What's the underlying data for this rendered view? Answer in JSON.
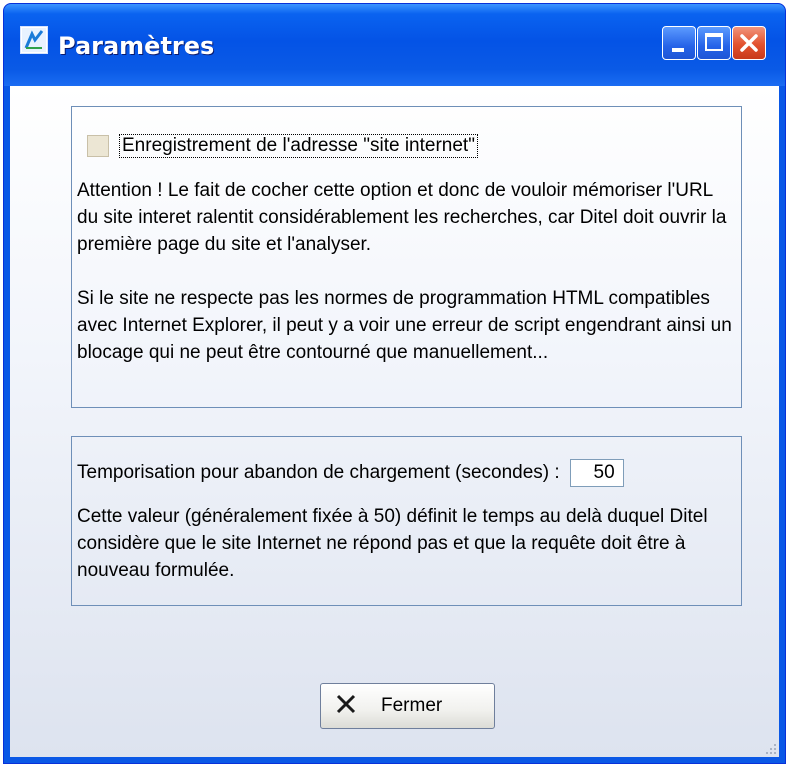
{
  "window": {
    "title": "Paramètres",
    "icon": "app-icon"
  },
  "internet_address": {
    "checkbox_label": "Enregistrement de l'adresse \"site internet\"",
    "checked": false,
    "warning_text": "Attention ! Le fait de cocher cette option et donc de vouloir mémoriser l'URL du site interet ralentit considérablement les recherches, car Ditel doit ouvrir la première page du site et l'analyser.",
    "script_text": "Si le site ne respecte pas les normes de programmation HTML compatibles avec Internet Explorer, il peut y a voir une erreur de script engendrant ainsi un blocage qui ne peut être contourné que manuellement..."
  },
  "timeout": {
    "label": "Temporisation pour abandon de chargement (secondes) :",
    "value": "50",
    "description": "Cette valeur (généralement fixée à 50) définit le temps au delà duquel Ditel considère que le site Internet ne répond pas et que la requête doit être à nouveau formulée."
  },
  "footer": {
    "close_label": "Fermer",
    "close_icon": "x-icon"
  },
  "colors": {
    "titlebar": "#0453e6",
    "close_button": "#e2512e",
    "group_border": "#6e8fb8"
  }
}
